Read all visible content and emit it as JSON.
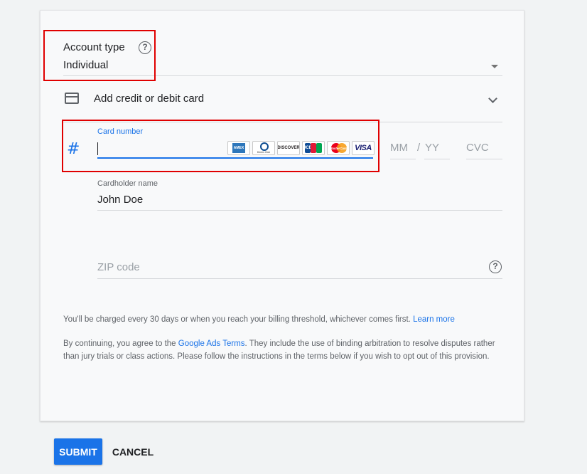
{
  "account_type": {
    "label": "Account type",
    "value": "Individual"
  },
  "payment_method": {
    "label": "Add credit or debit card"
  },
  "card_number": {
    "label": "Card number",
    "value": ""
  },
  "card_logos": [
    "AMEX",
    "Diners Club",
    "DISCOVER",
    "JCB",
    "MasterCard",
    "VISA"
  ],
  "expiry": {
    "month_placeholder": "MM",
    "separator": "/",
    "year_placeholder": "YY"
  },
  "cvc": {
    "placeholder": "CVC"
  },
  "cardholder": {
    "label": "Cardholder name",
    "value": "John Doe"
  },
  "zip": {
    "placeholder": "ZIP code"
  },
  "notice": {
    "billing_text": "You'll be charged every 30 days or when you reach your billing threshold, whichever comes first.",
    "learn_more": "Learn more",
    "terms_prefix": "By continuing, you agree to the",
    "terms_link": "Google Ads Terms",
    "terms_suffix": ". They include the use of binding arbitration to resolve disputes rather than jury trials or class actions. Please follow the instructions in the terms below if you wish to opt out of this provision."
  },
  "actions": {
    "submit": "SUBMIT",
    "cancel": "CANCEL"
  },
  "colors": {
    "accent": "#1a73e8",
    "highlight": "#e00000"
  }
}
